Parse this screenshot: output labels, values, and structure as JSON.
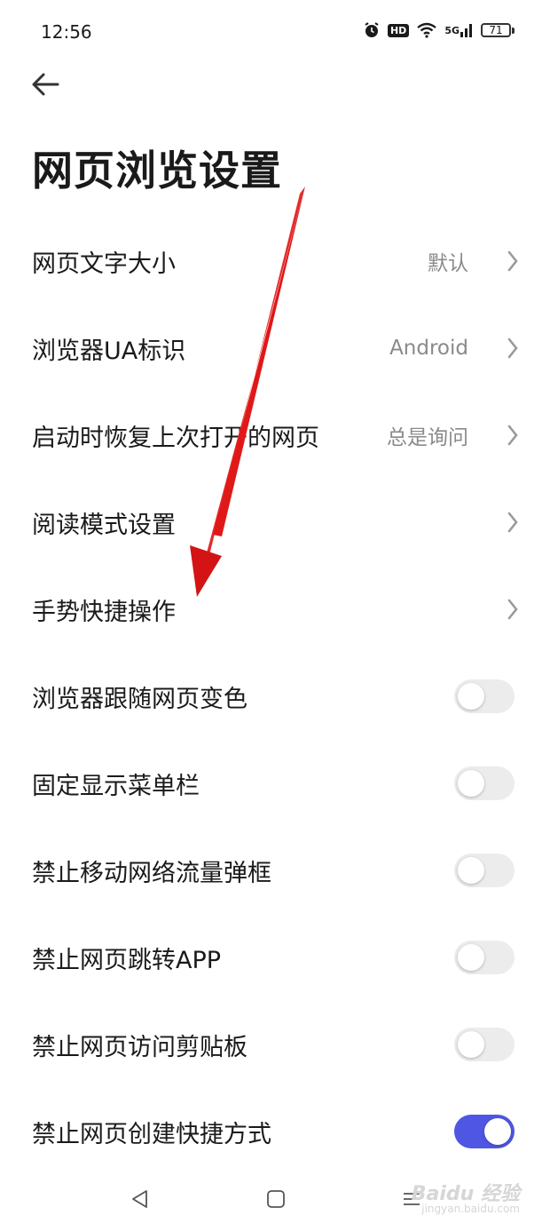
{
  "status": {
    "time": "12:56",
    "hd": "HD",
    "network": "5G",
    "battery": "71"
  },
  "header": {
    "back_icon": "arrow-left-icon",
    "title": "网页浏览设置"
  },
  "settings": [
    {
      "label": "网页文字大小",
      "value": "默认",
      "type": "nav"
    },
    {
      "label": "浏览器UA标识",
      "value": "Android",
      "type": "nav"
    },
    {
      "label": "启动时恢复上次打开的网页",
      "value": "总是询问",
      "type": "nav"
    },
    {
      "label": "阅读模式设置",
      "value": "",
      "type": "nav"
    },
    {
      "label": "手势快捷操作",
      "value": "",
      "type": "nav"
    },
    {
      "label": "浏览器跟随网页变色",
      "type": "toggle",
      "on": false
    },
    {
      "label": "固定显示菜单栏",
      "type": "toggle",
      "on": false
    },
    {
      "label": "禁止移动网络流量弹框",
      "type": "toggle",
      "on": false
    },
    {
      "label": "禁止网页跳转APP",
      "type": "toggle",
      "on": false
    },
    {
      "label": "禁止网页访问剪贴板",
      "type": "toggle",
      "on": false
    },
    {
      "label": "禁止网页创建快捷方式",
      "type": "toggle",
      "on": true
    }
  ],
  "nav": {
    "back_icon": "triangle-back-icon",
    "home_icon": "square-home-icon",
    "menu_icon": "menu-lines-icon"
  },
  "watermark": {
    "brand": "Baidu 经验",
    "url": "jingyan.baidu.com"
  },
  "colors": {
    "accent": "#4f56e3",
    "annotation_arrow": "#e01818",
    "toggle_off": "#ececec",
    "secondary_text": "#8a8a8a"
  }
}
